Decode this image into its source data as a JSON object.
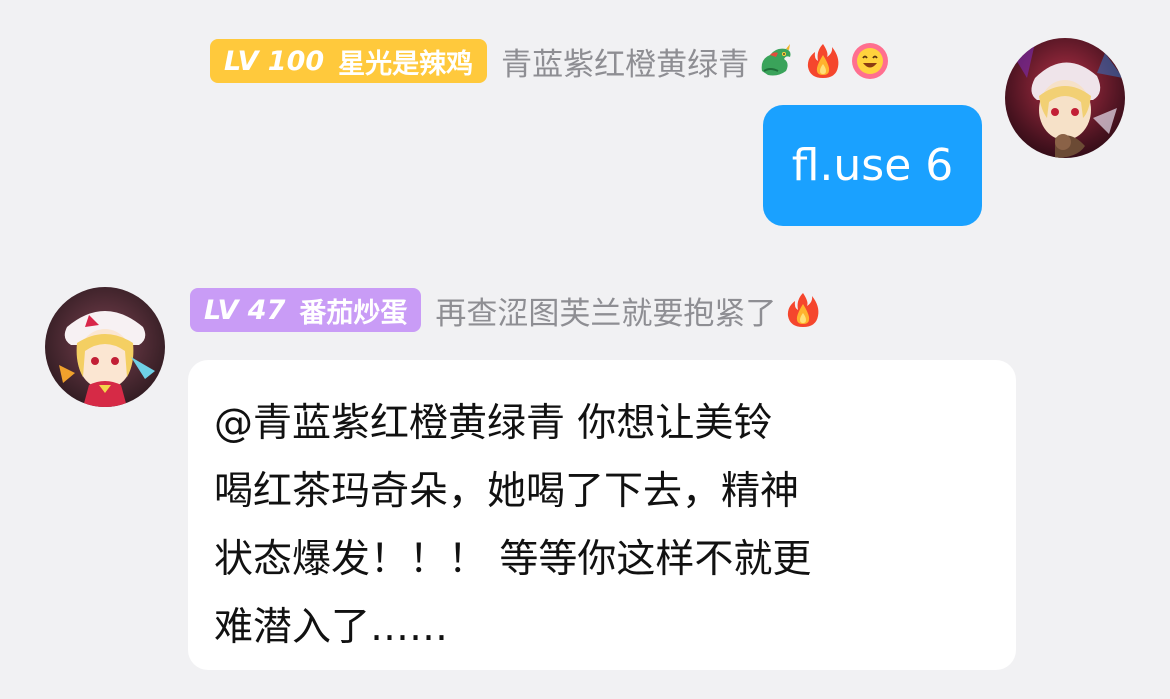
{
  "messages": [
    {
      "direction": "outgoing",
      "level": "LV 100",
      "level_label": "LV",
      "level_number": "100",
      "nickname": "星光是辣鸡",
      "title": "青蓝紫红橙黄绿青",
      "title_icons": [
        "dragon-icon",
        "fire-icon",
        "laughing-face-icon"
      ],
      "text": "fl.use 6",
      "badge_color": "#ffc93c",
      "bubble_color": "#1aa1ff"
    },
    {
      "direction": "incoming",
      "level_label": "LV",
      "level_number": "47",
      "nickname": "番茄炒蛋",
      "title": "再查涩图芙兰就要抱紧了",
      "title_icons": [
        "fire-icon"
      ],
      "text_lines": [
        "@青蓝紫红橙黄绿青 你想让美铃",
        "喝红茶玛奇朵，她喝了下去，精神",
        "状态爆发！！！ 等等你这样不就更",
        "难潜入了……"
      ],
      "badge_color": "#c99cf6",
      "bubble_color": "#ffffff"
    }
  ],
  "colors": {
    "background": "#f1f1f3",
    "title_text": "#8e8e93"
  }
}
